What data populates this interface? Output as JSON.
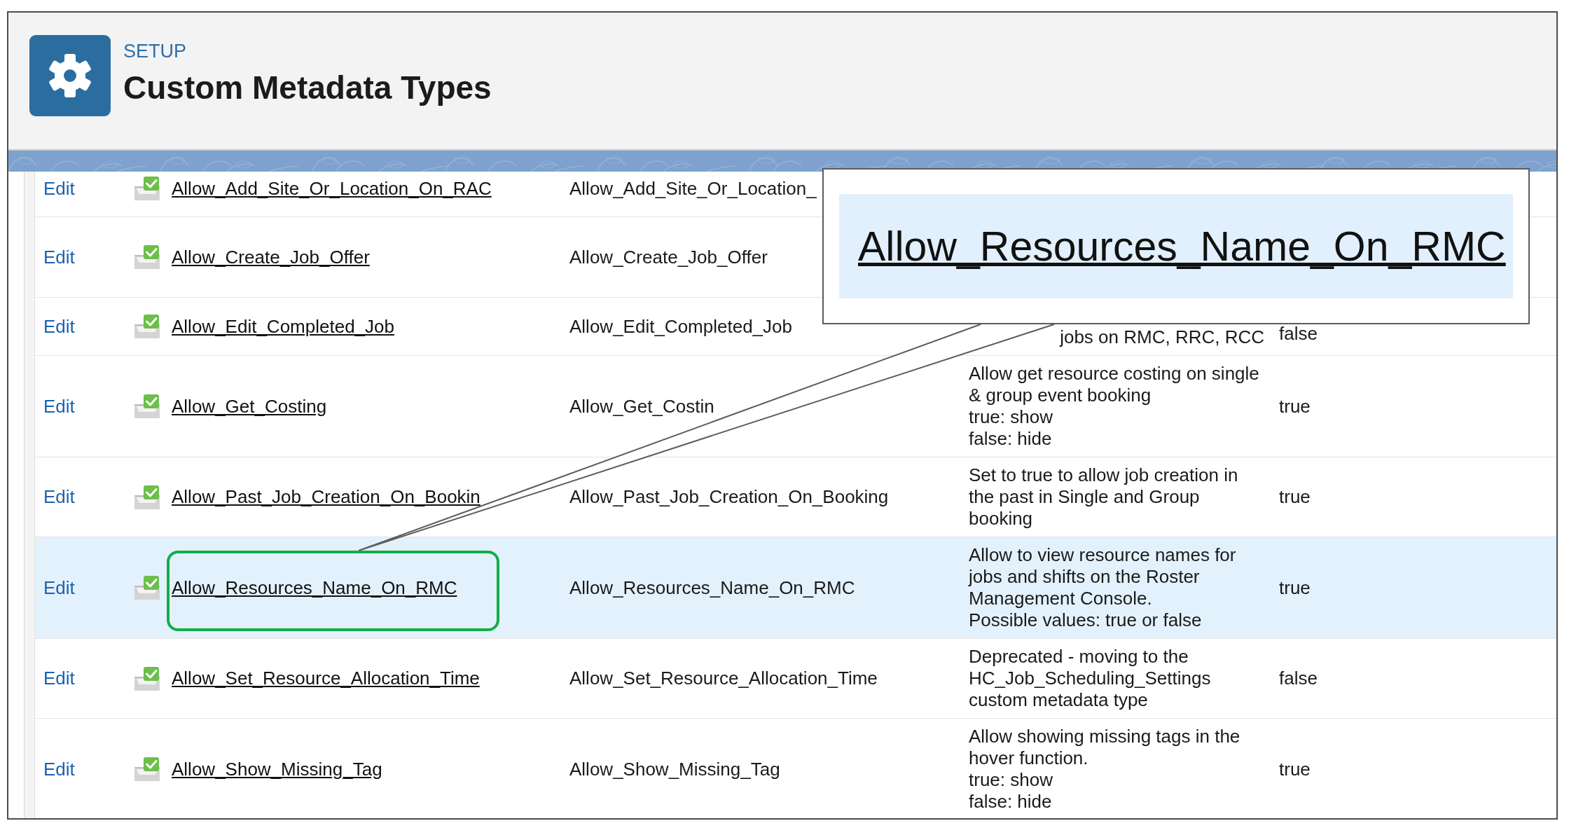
{
  "header": {
    "eyebrow": "SETUP",
    "title": "Custom Metadata Types"
  },
  "table": {
    "rows": [
      {
        "action": "Edit",
        "label": "Allow_Add_Site_Or_Location_On_RAC",
        "api_name": "Allow_Add_Site_Or_Location_",
        "selected": false
      },
      {
        "action": "Edit",
        "label": "Allow_Create_Job_Offer",
        "api_name": "Allow_Create_Job_Offer",
        "selected": false
      },
      {
        "action": "Edit",
        "label": "Allow_Edit_Completed_Job",
        "api_name": "Allow_Edit_Completed_Job",
        "description": "jobs on RMC, RRC, RCC",
        "value": "false",
        "selected": false
      },
      {
        "action": "Edit",
        "label": "Allow_Get_Costing",
        "api_name": "Allow_Get_Costin",
        "description": "Allow get resource costing on single & group event booking\ntrue: show\nfalse: hide",
        "value": "true",
        "selected": false
      },
      {
        "action": "Edit",
        "label": "Allow_Past_Job_Creation_On_Bookin",
        "api_name": "Allow_Past_Job_Creation_On_Booking",
        "description": "Set to true to allow job creation in the past in Single and Group booking",
        "value": "true",
        "selected": false
      },
      {
        "action": "Edit",
        "label": "Allow_Resources_Name_On_RMC",
        "api_name": "Allow_Resources_Name_On_RMC",
        "description": "Allow to view resource names for jobs and shifts on the Roster Management Console.\nPossible values: true or false",
        "value": "true",
        "selected": true
      },
      {
        "action": "Edit",
        "label": "Allow_Set_Resource_Allocation_Time",
        "api_name": "Allow_Set_Resource_Allocation_Time",
        "description": "Deprecated - moving to the HC_Job_Scheduling_Settings custom metadata type",
        "value": "false",
        "selected": false
      },
      {
        "action": "Edit",
        "label": "Allow_Show_Missing_Tag",
        "api_name": "Allow_Show_Missing_Tag",
        "description": "Allow showing missing tags in the hover function.\ntrue: show\nfalse: hide",
        "value": "true",
        "selected": false
      }
    ]
  },
  "callout": {
    "text": "Allow_Resources_Name_On_RMC"
  }
}
